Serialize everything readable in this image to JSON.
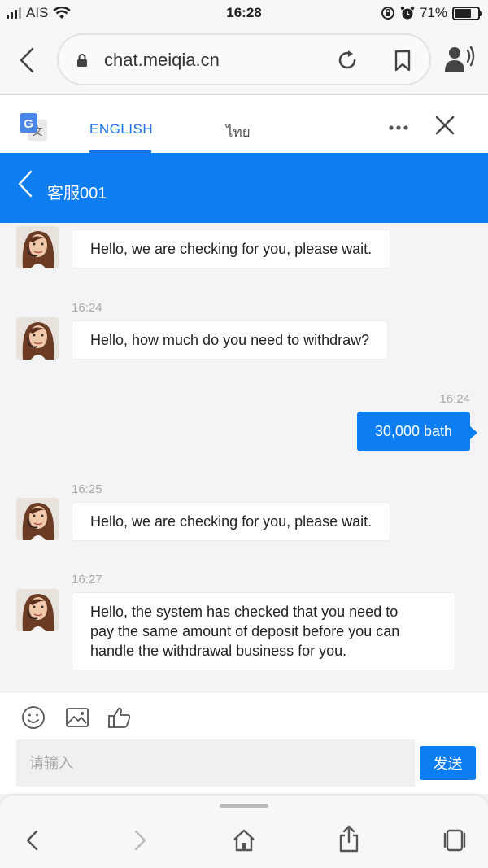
{
  "status_bar": {
    "carrier": "AIS",
    "time": "16:28",
    "battery": "71%",
    "battery_level": 0.71
  },
  "browser": {
    "url": "chat.meiqia.cn"
  },
  "translate_bar": {
    "active_language": "ENGLISH",
    "other_language": "ไทย"
  },
  "chat": {
    "title": "客服001",
    "messages": [
      {
        "from": "agent",
        "time": "",
        "text": "Hello, we are checking for you, please wait."
      },
      {
        "from": "agent",
        "time": "16:24",
        "text": "Hello, how much do you need to withdraw?"
      },
      {
        "from": "user",
        "time": "16:24",
        "text": "30,000 bath"
      },
      {
        "from": "agent",
        "time": "16:25",
        "text": "Hello, we are checking for you, please wait."
      },
      {
        "from": "agent",
        "time": "16:27",
        "text_lines": [
          "Hello, the system has checked that you need to",
          "pay the same amount of deposit before you can",
          "handle the withdrawal business for you."
        ]
      }
    ]
  },
  "compose": {
    "placeholder": "请输入",
    "send_label": "发送"
  },
  "colors": {
    "accent": "#0c7ef2",
    "translate_blue": "#1a73e8"
  },
  "icons": [
    "wifi-icon",
    "lock-rotation-icon",
    "alarm-icon",
    "battery-icon",
    "back-icon",
    "lock-icon",
    "reload-icon",
    "bookmark-icon",
    "speaker-icon",
    "google-translate-icon",
    "more-icon",
    "close-icon",
    "emoji-icon",
    "image-icon",
    "thumbs-up-icon",
    "forward-icon",
    "home-icon",
    "share-icon",
    "tabs-icon"
  ]
}
